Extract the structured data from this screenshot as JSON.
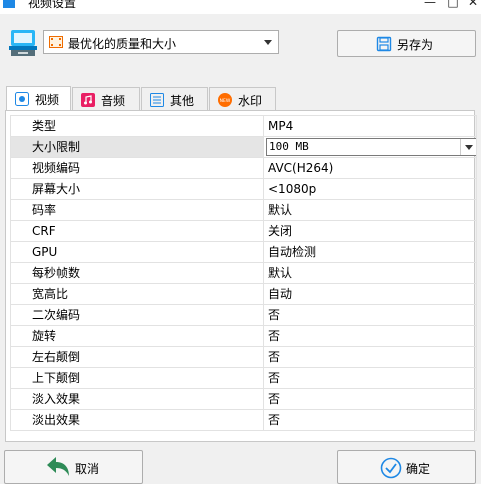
{
  "window": {
    "title": "视频设置",
    "minimize": "—",
    "maximize": "□",
    "close": "✕"
  },
  "preset": {
    "selected": "最优化的质量和大小",
    "save_as_label": "另存为"
  },
  "tabs": [
    {
      "label": "视频",
      "icon": "video-icon"
    },
    {
      "label": "音频",
      "icon": "music-icon"
    },
    {
      "label": "其他",
      "icon": "list-icon"
    },
    {
      "label": "水印",
      "icon": "new-badge-icon",
      "badge_text": "NEW"
    }
  ],
  "properties": [
    {
      "key": "类型",
      "value": "MP4"
    },
    {
      "key": "大小限制",
      "value": "100 MB"
    },
    {
      "key": "视频编码",
      "value": "AVC(H264)"
    },
    {
      "key": "屏幕大小",
      "value": "<1080p"
    },
    {
      "key": "码率",
      "value": "默认"
    },
    {
      "key": "CRF",
      "value": "关闭"
    },
    {
      "key": "GPU",
      "value": "自动检测"
    },
    {
      "key": "每秒帧数",
      "value": "默认"
    },
    {
      "key": "宽高比",
      "value": "自动"
    },
    {
      "key": "二次编码",
      "value": "否"
    },
    {
      "key": "旋转",
      "value": "否"
    },
    {
      "key": "左右颠倒",
      "value": "否"
    },
    {
      "key": "上下颠倒",
      "value": "否"
    },
    {
      "key": "淡入效果",
      "value": "否"
    },
    {
      "key": "淡出效果",
      "value": "否"
    }
  ],
  "footer": {
    "cancel_label": "取消",
    "ok_label": "确定"
  },
  "colors": {
    "accent_blue": "#1e88e5",
    "cancel_arrow": "#2e8b57",
    "music_tab": "#e91e63",
    "watermark_tab": "#ff6d00"
  }
}
